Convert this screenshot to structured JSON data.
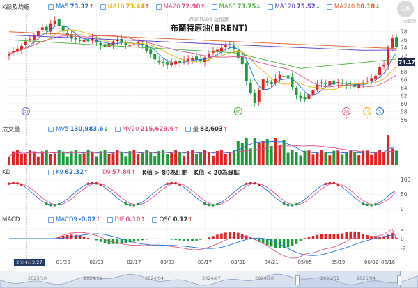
{
  "panels": {
    "price": {
      "title_label": "K線及均線",
      "chart_title": "布蘭特原油(BRENT)",
      "watermark": "WantGoo 玩股網",
      "items": [
        {
          "label": "MA5",
          "value": "73.32",
          "arrow": "↑",
          "color": "#1e6fd9"
        },
        {
          "label": "MA10",
          "value": "73.44",
          "arrow": "↑",
          "color": "#e8b400"
        },
        {
          "label": "MA20",
          "value": "72.90",
          "arrow": "↑",
          "color": "#e0508a"
        },
        {
          "label": "MA60",
          "value": "73.75",
          "arrow": "↓",
          "color": "#4cae3a"
        },
        {
          "label": "MA120",
          "value": "75.52",
          "arrow": "↓",
          "color": "#5b3fd1"
        },
        {
          "label": "MA240",
          "value": "80.18",
          "arrow": "↓",
          "color": "#e8622a"
        }
      ],
      "y_ticks": [
        "78",
        "76",
        "74",
        "72",
        "70",
        "68",
        "66",
        "64",
        "62",
        "60",
        "58",
        "56"
      ],
      "current_price": "74.17"
    },
    "volume": {
      "title_label": "成交量",
      "items": [
        {
          "label": "MV5",
          "value": "130,983.6",
          "arrow": "↓",
          "color": "#1e6fd9"
        },
        {
          "label": "MV20",
          "value": "215,629.6",
          "arrow": "↑",
          "color": "#e0508a"
        },
        {
          "label": "量",
          "value": "82,603",
          "arrow": "↑",
          "color": "#333333"
        }
      ]
    },
    "kd": {
      "title_label": "KD",
      "items": [
        {
          "label": "K9",
          "value": "62.32",
          "arrow": "↑",
          "color": "#1e6fd9"
        },
        {
          "label": "D9",
          "value": "57.84",
          "arrow": "↑",
          "color": "#e0508a"
        }
      ],
      "notes": [
        "K值 > 80為紅點",
        "K值 < 20為綠點"
      ],
      "y_ticks": [
        "100",
        "50",
        "0"
      ]
    },
    "macd": {
      "title_label": "MACD",
      "items": [
        {
          "label": "MACD9",
          "value": "-0.02",
          "arrow": "↑",
          "color": "#1e6fd9"
        },
        {
          "label": "DIF",
          "value": "0.10",
          "arrow": "↑",
          "color": "#e0508a"
        },
        {
          "label": "OSC",
          "value": "0.12",
          "arrow": "↑",
          "color": "#333333"
        }
      ],
      "y_ticks": [
        "2",
        "0",
        "-2"
      ]
    }
  },
  "event_badges": [
    {
      "label": "120",
      "color": "#7b4fd6"
    },
    {
      "label": "60",
      "color": "#4cae3a"
    },
    {
      "label": "20",
      "color": "#e0508a"
    },
    {
      "label": "10",
      "color": "#e8b400"
    },
    {
      "label": "5",
      "color": "#1e6fd9"
    }
  ],
  "x_ticks": [
    "01/06",
    "01/20",
    "02/03",
    "02/17",
    "03/03",
    "03/17",
    "03/31",
    "04/21",
    "05/05",
    "05/19",
    "06/02",
    "06/16"
  ],
  "crosshair_date": "2024/12/27",
  "navigator_labels": [
    "2023/10",
    "2024/01",
    "2024/04",
    "2024/07",
    "2024/10",
    "2025/01",
    "2025/04"
  ],
  "logo": {
    "text": "玩股",
    "sub": "玩股網"
  },
  "chart_data": {
    "type": "candlestick",
    "title": "布蘭特原油(BRENT)",
    "y_range": [
      56,
      79
    ],
    "closes": [
      72.5,
      73.1,
      73.8,
      74.5,
      75.6,
      76.2,
      77.1,
      78.2,
      79.1,
      78.4,
      80.1,
      80.8,
      79.6,
      78.1,
      77.2,
      76.3,
      76.1,
      75.8,
      75.9,
      75.6,
      76.4,
      75.3,
      74.6,
      74.3,
      75.1,
      75.6,
      75.9,
      75.3,
      74.8,
      74.6,
      74.9,
      75.4,
      74.8,
      73.2,
      72.5,
      71.1,
      70.4,
      70.1,
      69.8,
      70.2,
      70.6,
      70.3,
      70.9,
      71.2,
      71.5,
      71.0,
      70.8,
      71.6,
      72.4,
      73.2,
      73.5,
      74.0,
      74.6,
      74.8,
      73.6,
      71.4,
      69.9,
      65.6,
      62.8,
      60.2,
      63.4,
      66.1,
      65.3,
      64.9,
      66.3,
      67.2,
      66.8,
      66.5,
      64.2,
      62.1,
      61.3,
      61.0,
      62.4,
      63.5,
      64.8,
      65.3,
      64.9,
      65.6,
      64.8,
      65.4,
      65.0,
      64.6,
      64.8,
      64.2,
      64.9,
      65.3,
      65.7,
      66.4,
      67.0,
      69.1,
      69.8,
      74.2,
      76.4,
      74.17
    ],
    "ma_current": {
      "MA5": 73.32,
      "MA10": 73.44,
      "MA20": 72.9,
      "MA60": 73.75,
      "MA120": 75.52,
      "MA240": 80.18
    },
    "volume_last": 82603,
    "kd_last": {
      "K9": 62.32,
      "D9": 57.84
    },
    "macd_last": {
      "MACD9": -0.02,
      "DIF": 0.1,
      "OSC": 0.12
    }
  }
}
